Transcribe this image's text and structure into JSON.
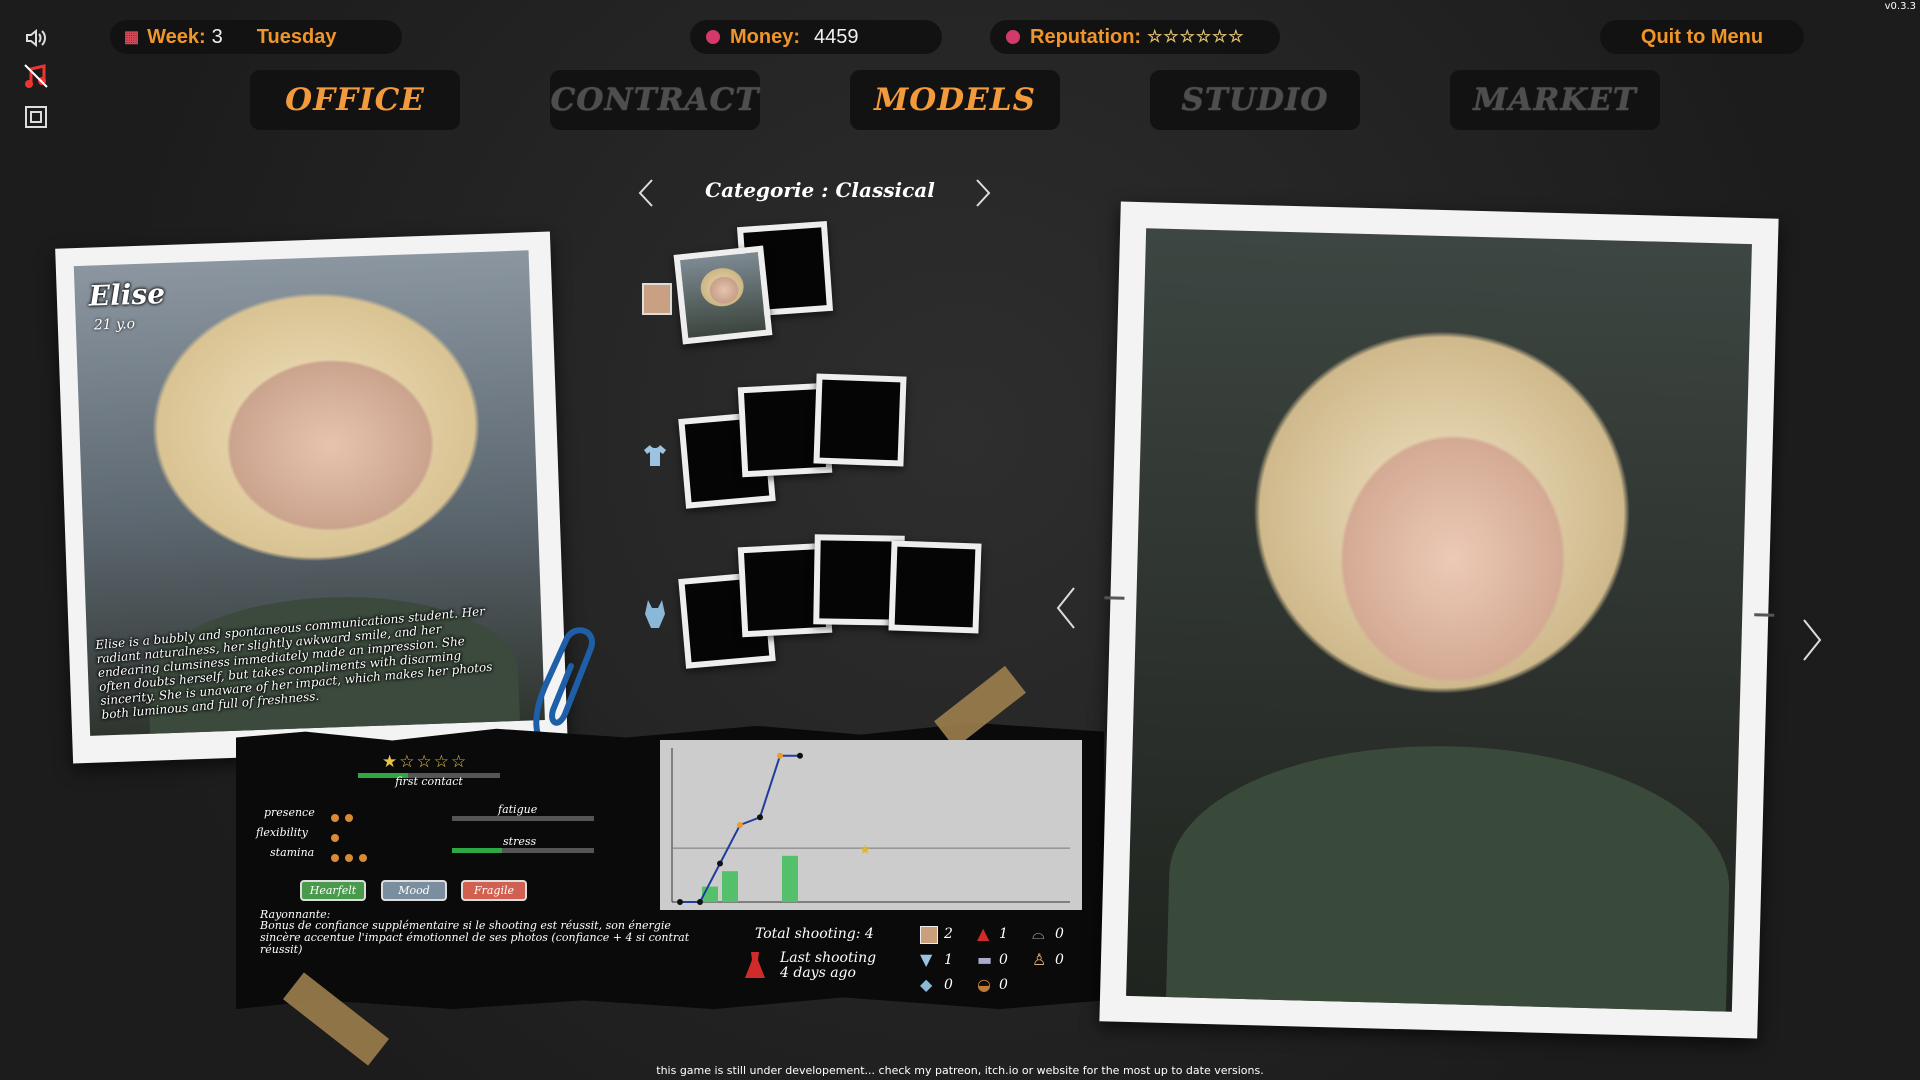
{
  "version": "v0.3.3",
  "topbar": {
    "week_label": "Week:",
    "week_value": "3",
    "day": "Tuesday",
    "money_label": "Money:",
    "money_value": "4459",
    "reputation_label": "Reputation:",
    "reputation_stars": "☆☆☆☆☆☆",
    "quit_label": "Quit to Menu"
  },
  "tabs": [
    {
      "label": "Office",
      "active": true
    },
    {
      "label": "Contract",
      "active": false
    },
    {
      "label": "Models",
      "active": true
    },
    {
      "label": "Studio",
      "active": false
    },
    {
      "label": "Market",
      "active": false
    }
  ],
  "category": {
    "label": "Categorie : Classical"
  },
  "model": {
    "name": "Elise",
    "age": "21 y.o",
    "description": "Elise is a bubbly and spontaneous communications student. Her radiant naturalness, her slightly awkward smile, and her endearing clumsiness immediately made an impression. She often doubts herself, but takes compliments with disarming sincerity. She is unaware of her impact, which makes her photos both luminous and full of freshness.",
    "rating_stars": "★☆☆☆☆",
    "rating": 1,
    "relation_label": "first contact",
    "relation_progress": 0.35,
    "stats": [
      {
        "label": "presence",
        "dots": 2
      },
      {
        "label": "flexibility",
        "dots": 1
      },
      {
        "label": "stamina",
        "dots": 3
      }
    ],
    "fatigue_label": "fatigue",
    "fatigue_level": 0,
    "stress_label": "stress",
    "stress_level": 0.35,
    "traits": [
      {
        "label": "Hearfelt",
        "color": "#4a9a4c"
      },
      {
        "label": "Mood",
        "color": "#7a8ea0"
      },
      {
        "label": "Fragile",
        "color": "#d26050"
      }
    ],
    "perk_title": "Rayonnante:",
    "perk_text": "Bonus de confiance supplémentaire si le shooting est réussit, son énergie sincère accentue l'impact émotionnel de ses photos (confiance + 4 si contrat réussit)"
  },
  "shooting": {
    "total_label": "Total shooting: 4",
    "last_label": "Last shooting",
    "last_value": "4 days ago",
    "counts": [
      {
        "icon": "portrait-icon",
        "value": "2"
      },
      {
        "icon": "dress-icon",
        "value": "1"
      },
      {
        "icon": "lingerie-icon",
        "value": "0"
      },
      {
        "icon": "tshirt-icon",
        "value": "1"
      },
      {
        "icon": "chair-icon",
        "value": "0"
      },
      {
        "icon": "pose-icon",
        "value": "0"
      },
      {
        "icon": "swimsuit-icon",
        "value": "0"
      },
      {
        "icon": "mask-icon",
        "value": "0"
      }
    ]
  },
  "chart_data": {
    "type": "line",
    "line": [
      0,
      0,
      2.5,
      5,
      5.5,
      9.5,
      9.5
    ],
    "bars": [
      1,
      2,
      0,
      0,
      3
    ],
    "ylim": [
      0,
      10
    ],
    "threshold": 3.5,
    "star_marker": "★",
    "colors": {
      "line": "#1f3d9c",
      "bar": "#55c06a",
      "point": "#111111",
      "highlight": "#f09a2a"
    }
  },
  "footer": {
    "note": "this game is still under developement... check my patreon, itch.io or website for the most up to date versions."
  }
}
